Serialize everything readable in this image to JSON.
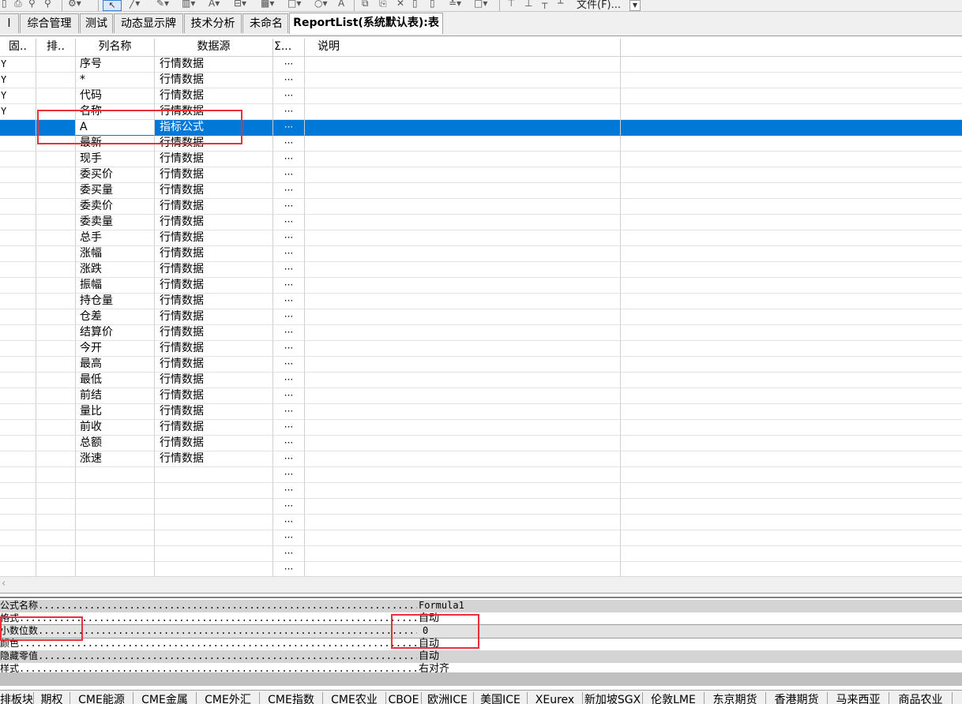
{
  "toolbar": {
    "file_menu_label": "文件(F)...",
    "icons": [
      "save-icon",
      "search-icon",
      "zoom-icon",
      "gear-icon",
      "cursor-icon",
      "line-icon",
      "draw-icon",
      "chart-icon",
      "text-icon",
      "rect-icon",
      "circle-icon",
      "font-icon",
      "copy-icon",
      "paste-icon",
      "delete-icon",
      "undo-icon",
      "redo-icon",
      "align-icon",
      "grid-icon"
    ]
  },
  "tabs": [
    {
      "label": "l"
    },
    {
      "label": "综合管理"
    },
    {
      "label": "测试"
    },
    {
      "label": "动态显示牌"
    },
    {
      "label": "技术分析"
    },
    {
      "label": "未命名"
    },
    {
      "label": "ReportList(系统默认表):表"
    }
  ],
  "grid": {
    "headers": {
      "fixed": "固..",
      "sort": "排..",
      "name": "列名称",
      "source": "数据源",
      "sum": "Σ...",
      "desc": "说明"
    },
    "rows": [
      {
        "fixed": "Y",
        "name": "序号",
        "source": "行情数据",
        "sum": "···"
      },
      {
        "fixed": "Y",
        "name": "*",
        "source": "行情数据",
        "sum": "···"
      },
      {
        "fixed": "Y",
        "name": "代码",
        "source": "行情数据",
        "sum": "···"
      },
      {
        "fixed": "Y",
        "name": "名称",
        "source": "行情数据",
        "sum": "···"
      },
      {
        "fixed": "",
        "name": "A",
        "source": "指标公式",
        "sum": "···",
        "selected": true
      },
      {
        "fixed": "",
        "name": "最新",
        "source": "行情数据",
        "sum": "···"
      },
      {
        "fixed": "",
        "name": "现手",
        "source": "行情数据",
        "sum": "···"
      },
      {
        "fixed": "",
        "name": "委买价",
        "source": "行情数据",
        "sum": "···"
      },
      {
        "fixed": "",
        "name": "委买量",
        "source": "行情数据",
        "sum": "···"
      },
      {
        "fixed": "",
        "name": "委卖价",
        "source": "行情数据",
        "sum": "···"
      },
      {
        "fixed": "",
        "name": "委卖量",
        "source": "行情数据",
        "sum": "···"
      },
      {
        "fixed": "",
        "name": "总手",
        "source": "行情数据",
        "sum": "···"
      },
      {
        "fixed": "",
        "name": "涨幅",
        "source": "行情数据",
        "sum": "···"
      },
      {
        "fixed": "",
        "name": "涨跌",
        "source": "行情数据",
        "sum": "···"
      },
      {
        "fixed": "",
        "name": "振幅",
        "source": "行情数据",
        "sum": "···"
      },
      {
        "fixed": "",
        "name": "持仓量",
        "source": "行情数据",
        "sum": "···"
      },
      {
        "fixed": "",
        "name": "仓差",
        "source": "行情数据",
        "sum": "···"
      },
      {
        "fixed": "",
        "name": "结算价",
        "source": "行情数据",
        "sum": "···"
      },
      {
        "fixed": "",
        "name": "今开",
        "source": "行情数据",
        "sum": "···"
      },
      {
        "fixed": "",
        "name": "最高",
        "source": "行情数据",
        "sum": "···"
      },
      {
        "fixed": "",
        "name": "最低",
        "source": "行情数据",
        "sum": "···"
      },
      {
        "fixed": "",
        "name": "前结",
        "source": "行情数据",
        "sum": "···"
      },
      {
        "fixed": "",
        "name": "量比",
        "source": "行情数据",
        "sum": "···"
      },
      {
        "fixed": "",
        "name": "前收",
        "source": "行情数据",
        "sum": "···"
      },
      {
        "fixed": "",
        "name": "总额",
        "source": "行情数据",
        "sum": "···"
      },
      {
        "fixed": "",
        "name": "涨速",
        "source": "行情数据",
        "sum": "···"
      },
      {
        "fixed": "",
        "name": "",
        "source": "",
        "sum": "···"
      },
      {
        "fixed": "",
        "name": "",
        "source": "",
        "sum": "···"
      },
      {
        "fixed": "",
        "name": "",
        "source": "",
        "sum": "···"
      },
      {
        "fixed": "",
        "name": "",
        "source": "",
        "sum": "···"
      },
      {
        "fixed": "",
        "name": "",
        "source": "",
        "sum": "···"
      },
      {
        "fixed": "",
        "name": "",
        "source": "",
        "sum": "···"
      },
      {
        "fixed": "",
        "name": "",
        "source": "",
        "sum": "···"
      }
    ]
  },
  "properties": [
    {
      "label": "公式名称",
      "value": "Formula1"
    },
    {
      "label": "格式",
      "value": "自动"
    },
    {
      "label": "小数位数",
      "value": "0"
    },
    {
      "label": "颜色",
      "value": "自动"
    },
    {
      "label": "隐藏零值",
      "value": "自动"
    },
    {
      "label": "样式",
      "value": "右对齐"
    }
  ],
  "market_tabs": [
    {
      "label": "排板块"
    },
    {
      "label": "期权"
    },
    {
      "label": "CME能源"
    },
    {
      "label": "CME金属"
    },
    {
      "label": "CME外汇"
    },
    {
      "label": "CME指数"
    },
    {
      "label": "CME农业"
    },
    {
      "label": "CBOE"
    },
    {
      "label": "欧洲ICE"
    },
    {
      "label": "美国ICE"
    },
    {
      "label": "XEurex"
    },
    {
      "label": "新加坡SGX"
    },
    {
      "label": "伦敦LME"
    },
    {
      "label": "东京期货"
    },
    {
      "label": "香港期货"
    },
    {
      "label": "马来西亚"
    },
    {
      "label": "商品农业"
    }
  ],
  "colors": {
    "selection": "#0078d7",
    "annotation": "#e8313a",
    "property_stripe": "#d4d4d4"
  }
}
